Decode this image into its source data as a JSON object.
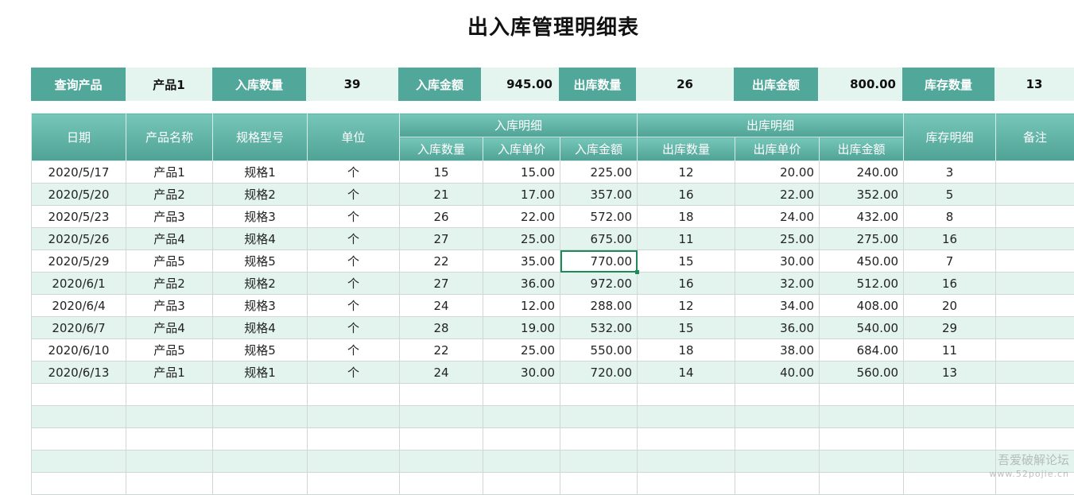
{
  "title": "出入库管理明细表",
  "summary": {
    "query_label": "查询产品",
    "query_value": "产品1",
    "in_qty_label": "入库数量",
    "in_qty_value": "39",
    "in_amt_label": "入库金额",
    "in_amt_value": "945.00",
    "out_qty_label": "出库数量",
    "out_qty_value": "26",
    "out_amt_label": "出库金额",
    "out_amt_value": "800.00",
    "stock_label": "库存数量",
    "stock_value": "13"
  },
  "headers": {
    "date": "日期",
    "product": "产品名称",
    "spec": "规格型号",
    "unit": "单位",
    "in_group": "入库明细",
    "out_group": "出库明细",
    "in_qty": "入库数量",
    "in_price": "入库单价",
    "in_amt": "入库金额",
    "out_qty": "出库数量",
    "out_price": "出库单价",
    "out_amt": "出库金额",
    "stock": "库存明细",
    "note": "备注"
  },
  "rows": [
    [
      "2020/5/17",
      "产品1",
      "规格1",
      "个",
      "15",
      "15.00",
      "225.00",
      "12",
      "20.00",
      "240.00",
      "3",
      ""
    ],
    [
      "2020/5/20",
      "产品2",
      "规格2",
      "个",
      "21",
      "17.00",
      "357.00",
      "16",
      "22.00",
      "352.00",
      "5",
      ""
    ],
    [
      "2020/5/23",
      "产品3",
      "规格3",
      "个",
      "26",
      "22.00",
      "572.00",
      "18",
      "24.00",
      "432.00",
      "8",
      ""
    ],
    [
      "2020/5/26",
      "产品4",
      "规格4",
      "个",
      "27",
      "25.00",
      "675.00",
      "11",
      "25.00",
      "275.00",
      "16",
      ""
    ],
    [
      "2020/5/29",
      "产品5",
      "规格5",
      "个",
      "22",
      "35.00",
      "770.00",
      "15",
      "30.00",
      "450.00",
      "7",
      ""
    ],
    [
      "2020/6/1",
      "产品2",
      "规格2",
      "个",
      "27",
      "36.00",
      "972.00",
      "16",
      "32.00",
      "512.00",
      "16",
      ""
    ],
    [
      "2020/6/4",
      "产品3",
      "规格3",
      "个",
      "24",
      "12.00",
      "288.00",
      "12",
      "34.00",
      "408.00",
      "20",
      ""
    ],
    [
      "2020/6/7",
      "产品4",
      "规格4",
      "个",
      "28",
      "19.00",
      "532.00",
      "15",
      "36.00",
      "540.00",
      "29",
      ""
    ],
    [
      "2020/6/10",
      "产品5",
      "规格5",
      "个",
      "22",
      "25.00",
      "550.00",
      "18",
      "38.00",
      "684.00",
      "11",
      ""
    ],
    [
      "2020/6/13",
      "产品1",
      "规格1",
      "个",
      "24",
      "30.00",
      "720.00",
      "14",
      "40.00",
      "560.00",
      "13",
      ""
    ],
    [
      "",
      "",
      "",
      "",
      "",
      "",
      "",
      "",
      "",
      "",
      "",
      ""
    ],
    [
      "",
      "",
      "",
      "",
      "",
      "",
      "",
      "",
      "",
      "",
      "",
      ""
    ],
    [
      "",
      "",
      "",
      "",
      "",
      "",
      "",
      "",
      "",
      "",
      "",
      ""
    ],
    [
      "",
      "",
      "",
      "",
      "",
      "",
      "",
      "",
      "",
      "",
      "",
      ""
    ],
    [
      "",
      "",
      "",
      "",
      "",
      "",
      "",
      "",
      "",
      "",
      "",
      ""
    ]
  ],
  "watermark": {
    "line1": "吾爱破解论坛",
    "line2": "www.52pojie.cn"
  }
}
